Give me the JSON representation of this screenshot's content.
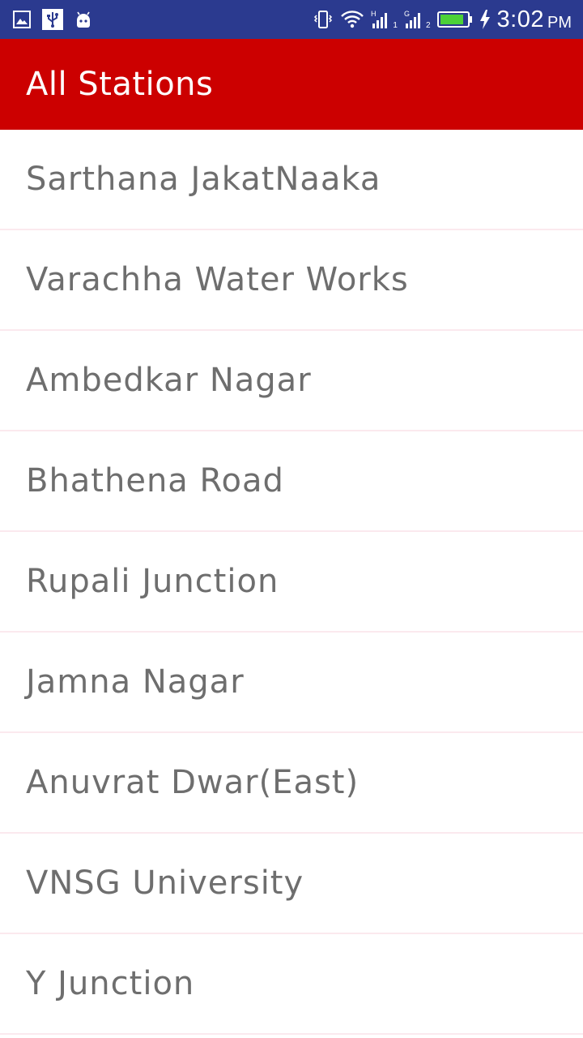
{
  "status_bar": {
    "left_icons": [
      "image-icon",
      "usb-icon",
      "android-icon"
    ],
    "right_icons": [
      "vibrate-icon",
      "wifi-icon",
      "signal-sim1-icon",
      "signal-sim2-icon",
      "battery-icon",
      "charging-icon"
    ],
    "sim1_network": "H",
    "sim1_sub": "1",
    "sim2_network": "G",
    "sim2_sub": "2",
    "time": "3:02",
    "ampm": "PM"
  },
  "app_bar": {
    "title": "All Stations",
    "color": "#cc0000"
  },
  "stations": [
    {
      "name": "Sarthana JakatNaaka"
    },
    {
      "name": "Varachha Water Works"
    },
    {
      "name": "Ambedkar Nagar"
    },
    {
      "name": "Bhathena Road"
    },
    {
      "name": "Rupali Junction"
    },
    {
      "name": "Jamna Nagar"
    },
    {
      "name": "Anuvrat Dwar(East)"
    },
    {
      "name": "VNSG University"
    },
    {
      "name": "Y Junction"
    }
  ]
}
